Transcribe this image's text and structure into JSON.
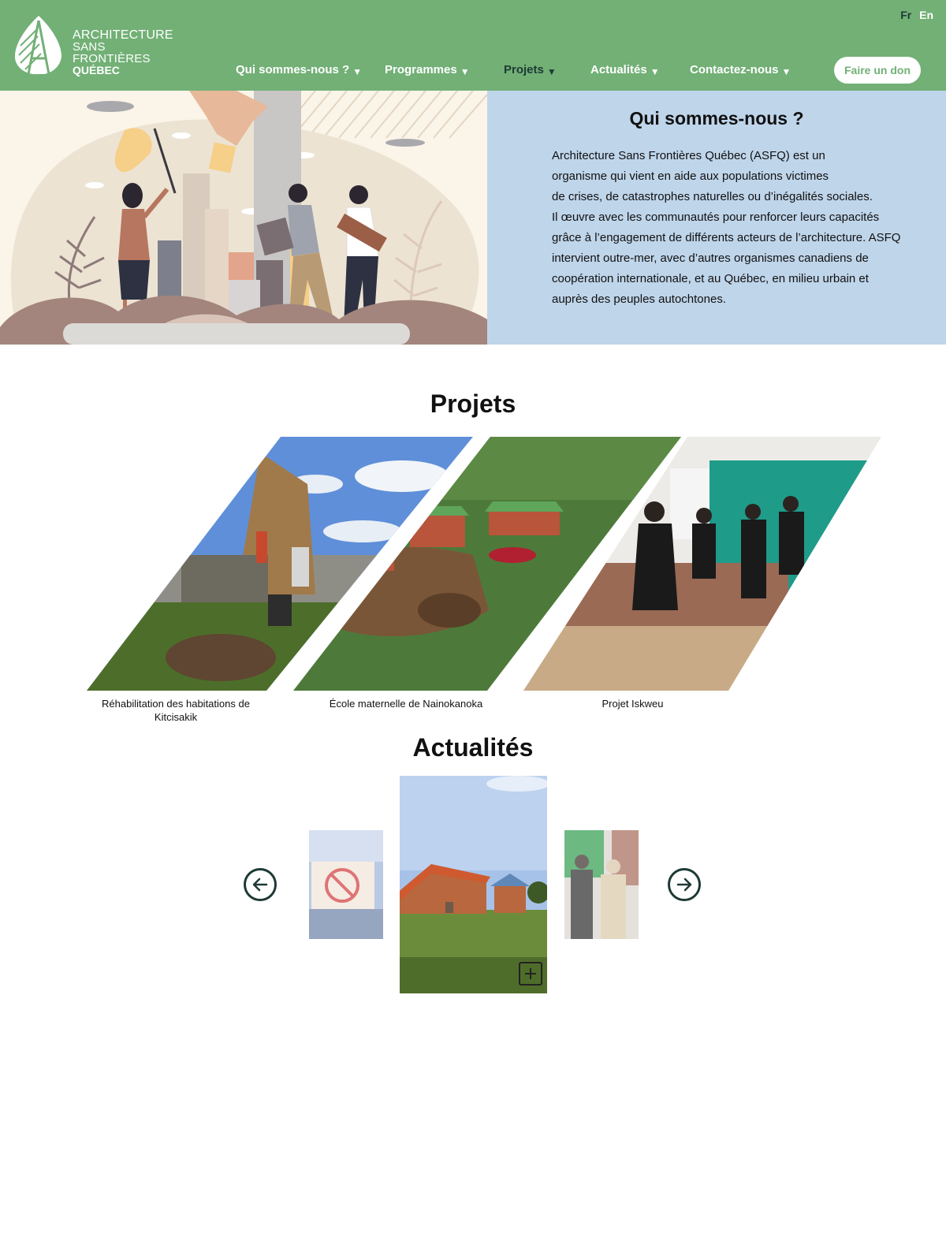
{
  "header": {
    "logo": {
      "line1": "ARCHITECTURE",
      "line2": "SANS FRONTIÈRES",
      "line3": "QUÉBEC"
    },
    "lang": {
      "fr": "Fr",
      "en": "En"
    },
    "nav": [
      {
        "label": "Qui sommes-nous ?",
        "active": false
      },
      {
        "label": "Programmes",
        "active": false
      },
      {
        "label": "Projets",
        "active": true
      },
      {
        "label": "Actualités",
        "active": false
      },
      {
        "label": "Contactez-nous",
        "active": false
      }
    ],
    "caret": "▼",
    "donate_label": "Faire un don"
  },
  "about": {
    "title": "Qui sommes-nous ?",
    "body": "Architecture Sans Frontières Québec (ASFQ) est un\norganisme qui vient en aide aux populations victimes\n de crises, de catastrophes naturelles ou d’inégalités sociales.\nIl œuvre avec les communautés pour renforcer leurs capacités\ngrâce à l’engagement de différents acteurs de l’architecture. ASFQ\n intervient outre-mer, avec d’autres organismes canadiens de\n coopération internationale, et au Québec, en milieu urbain et\nauprès des peuples autochtones."
  },
  "projects": {
    "title": "Projets",
    "items": [
      {
        "caption": "Réhabilitation des habitations de Kitcisakik"
      },
      {
        "caption": "École maternelle de Nainokanoka"
      },
      {
        "caption": "Projet Iskweu"
      }
    ]
  },
  "news": {
    "title": "Actualités",
    "prev_icon": "arrow-left-icon",
    "next_icon": "arrow-right-icon",
    "more_icon": "plus-icon"
  },
  "colors": {
    "header_green": "#72b076",
    "dark_teal": "#1e3a36",
    "about_blue": "#bfd5ea"
  }
}
